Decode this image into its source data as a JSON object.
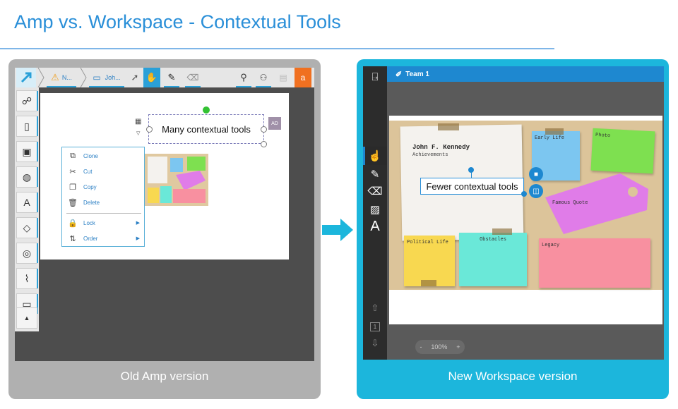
{
  "title": "Amp vs. Workspace - Contextual Tools",
  "old_version": {
    "caption": "Old Amp version",
    "toolbar": {
      "breadcrumb_1": "N...",
      "breadcrumb_2": "Joh...",
      "orange_button": "a"
    },
    "textbox_text": "Many contextual tools",
    "ad_badge": "AD",
    "context_menu": {
      "items": [
        {
          "label": "Clone",
          "icon": "clone-icon"
        },
        {
          "label": "Cut",
          "icon": "scissors-icon"
        },
        {
          "label": "Copy",
          "icon": "copy-icon"
        },
        {
          "label": "Delete",
          "icon": "trash-icon"
        },
        {
          "label": "Lock",
          "icon": "lock-icon"
        },
        {
          "label": "Order",
          "icon": "order-icon"
        }
      ]
    }
  },
  "new_version": {
    "caption": "New Workspace version",
    "header_title": "Team 1",
    "textbox_text": "Fewer contextual tools",
    "zoom": {
      "minus": "-",
      "value": "100%",
      "plus": "+"
    },
    "page_number": "1",
    "board": {
      "paper_title": "John F. Kennedy",
      "paper_subtitle": "Achievements",
      "notes": [
        "Early Life",
        "Photo",
        "Famous Quote",
        "Political Life",
        "Obstacles",
        "Legacy"
      ]
    }
  },
  "colors": {
    "accent": "#2a8fd8",
    "left_panel": "#b0b0b0",
    "right_panel": "#1cb6dc",
    "workspace_header": "#1e88d0"
  }
}
